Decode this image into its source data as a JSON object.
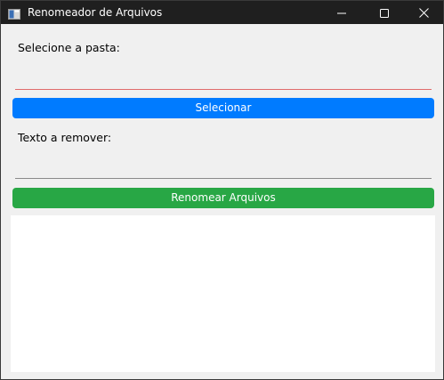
{
  "window": {
    "title": "Renomeador de Arquivos",
    "icon": "app-window-icon"
  },
  "titlebar_controls": {
    "minimize_icon": "minimize-icon",
    "maximize_icon": "maximize-icon",
    "close_icon": "close-icon"
  },
  "folder": {
    "label": "Selecione a pasta:",
    "value": "",
    "placeholder": ""
  },
  "select_button": {
    "label": "Selecionar",
    "color": "#007bff"
  },
  "remove_text": {
    "label": "Texto a remover:",
    "value": "",
    "placeholder": ""
  },
  "rename_button": {
    "label": "Renomear Arquivos",
    "color": "#28a745"
  },
  "log": {
    "text": ""
  }
}
